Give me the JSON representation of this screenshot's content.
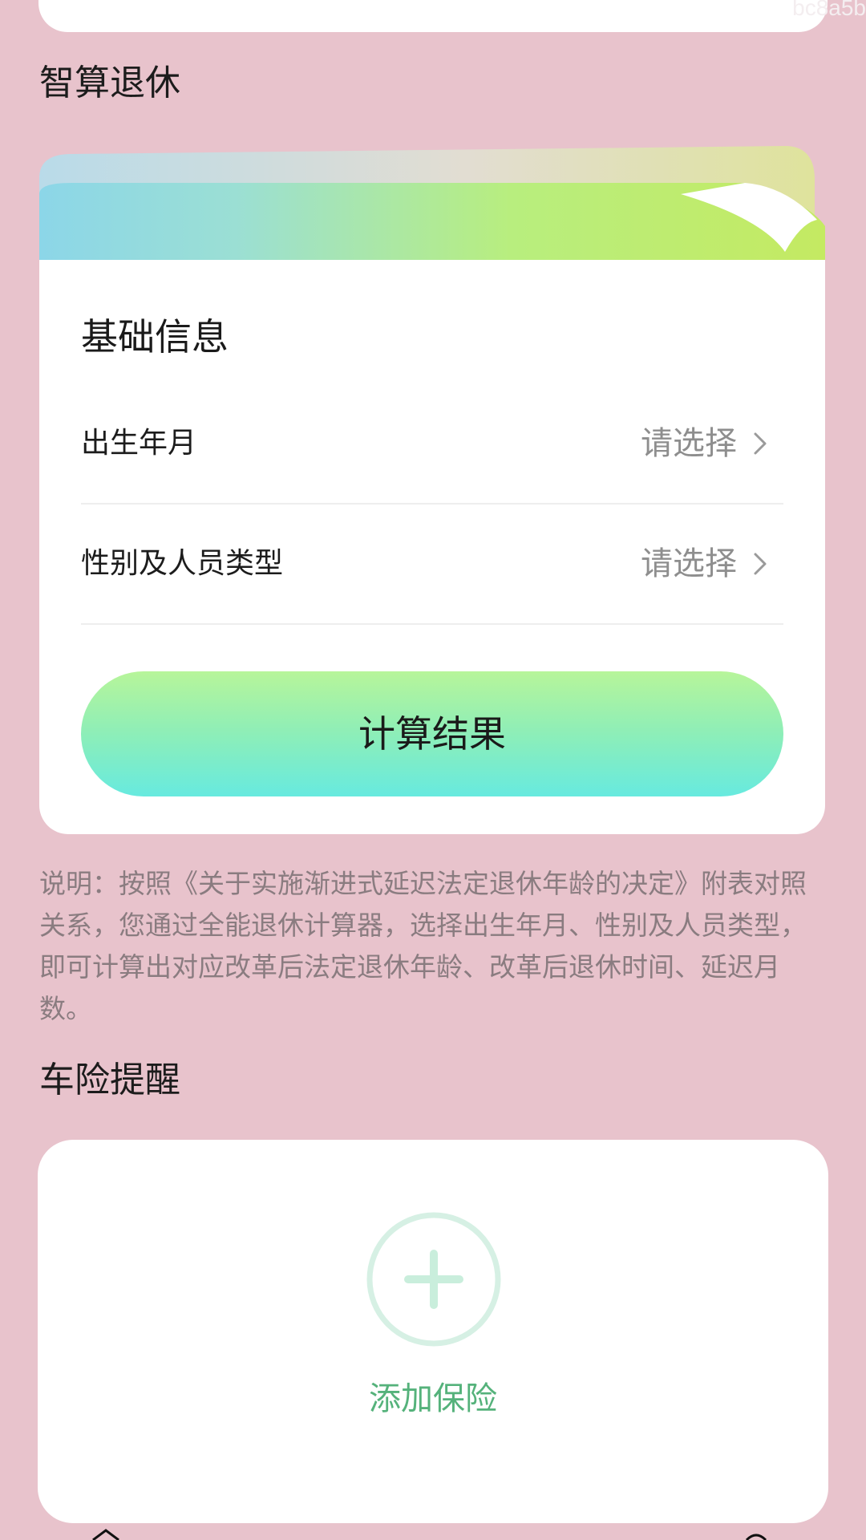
{
  "watermark": "bc8a5b",
  "retire": {
    "section_title": "智算退休",
    "card_title": "基础信息",
    "rows": [
      {
        "label": "出生年月",
        "value": "请选择"
      },
      {
        "label": "性别及人员类型",
        "value": "请选择"
      }
    ],
    "calc_button": "计算结果",
    "note": "说明：按照《关于实施渐进式延迟法定退休年龄的决定》附表对照关系，您通过全能退休计算器，选择出生年月、性别及人员类型，即可计算出对应改革后法定退休年龄、改革后退休时间、延迟月数。"
  },
  "insurance": {
    "section_title": "车险提醒",
    "add_label": "添加保险"
  },
  "icons": {
    "row_arrow": "chevron-right-icon",
    "add": "plus-circle-icon",
    "nav": [
      "home-icon",
      "profile-icon"
    ]
  },
  "colors": {
    "background": "#e8c3cc",
    "button_top": "#b7f59a",
    "button_bottom": "#67eadf",
    "add_green": "#55b27b",
    "add_circle": "#d6f0e4"
  }
}
